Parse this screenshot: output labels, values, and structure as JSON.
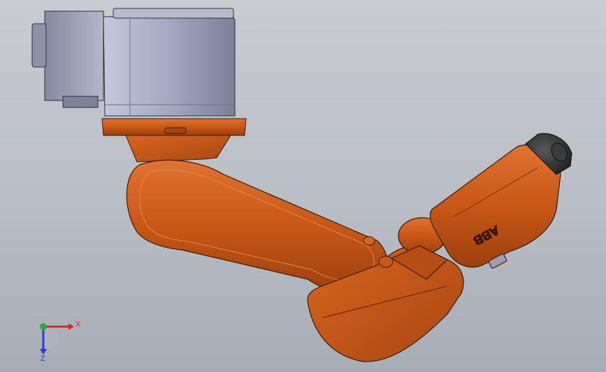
{
  "viewport": {
    "background_top": "#c9ccd1",
    "background_bottom": "#a7adb5"
  },
  "model": {
    "brand_logo_text": "ABB",
    "colors": {
      "robot_orange": "#c9581a",
      "robot_orange_dark": "#8a3a0e",
      "robot_orange_light": "#e2783a",
      "mount_gray": "#9ea3bd",
      "mount_gray_dark": "#7b7f97",
      "outline": "#2a1a10",
      "tool_flange": "#2e2e30"
    }
  },
  "triad": {
    "x_label": "X",
    "z_label": "Z",
    "x_color": "#d8242a",
    "y_color": "#2aa84a",
    "z_color": "#2a3bd8"
  }
}
